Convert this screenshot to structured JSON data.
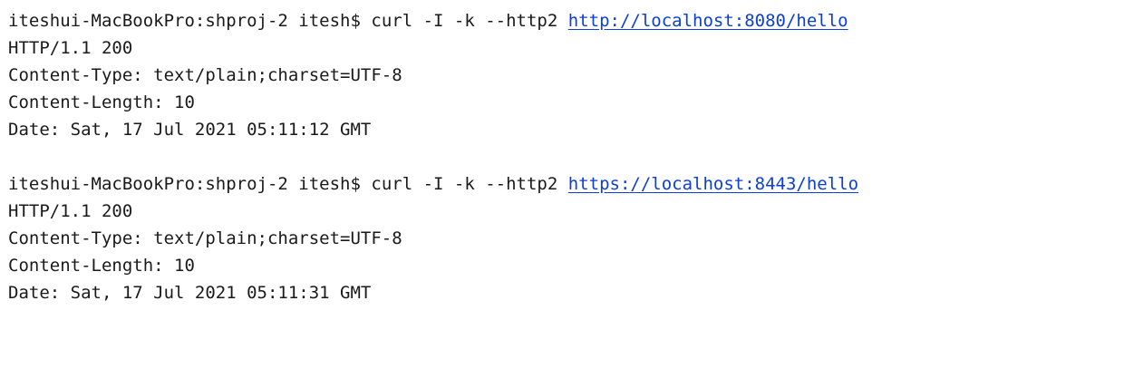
{
  "session": {
    "commands": [
      {
        "prompt": "iteshui-MacBookPro:shproj-2 itesh$",
        "command": "curl -I -k --http2",
        "url": "http://localhost:8080/hello",
        "response": {
          "status": "HTTP/1.1 200",
          "content_type": "Content-Type: text/plain;charset=UTF-8",
          "content_length": "Content-Length: 10",
          "date": "Date: Sat, 17 Jul 2021 05:11:12 GMT"
        }
      },
      {
        "prompt": "iteshui-MacBookPro:shproj-2 itesh$",
        "command": "curl -I -k --http2",
        "url": "https://localhost:8443/hello",
        "response": {
          "status": "HTTP/1.1 200",
          "content_type": "Content-Type: text/plain;charset=UTF-8",
          "content_length": "Content-Length: 10",
          "date": "Date: Sat, 17 Jul 2021 05:11:31 GMT"
        }
      }
    ]
  },
  "colors": {
    "text": "#1a1a1a",
    "link": "#0b3fd6",
    "background": "#ffffff"
  }
}
